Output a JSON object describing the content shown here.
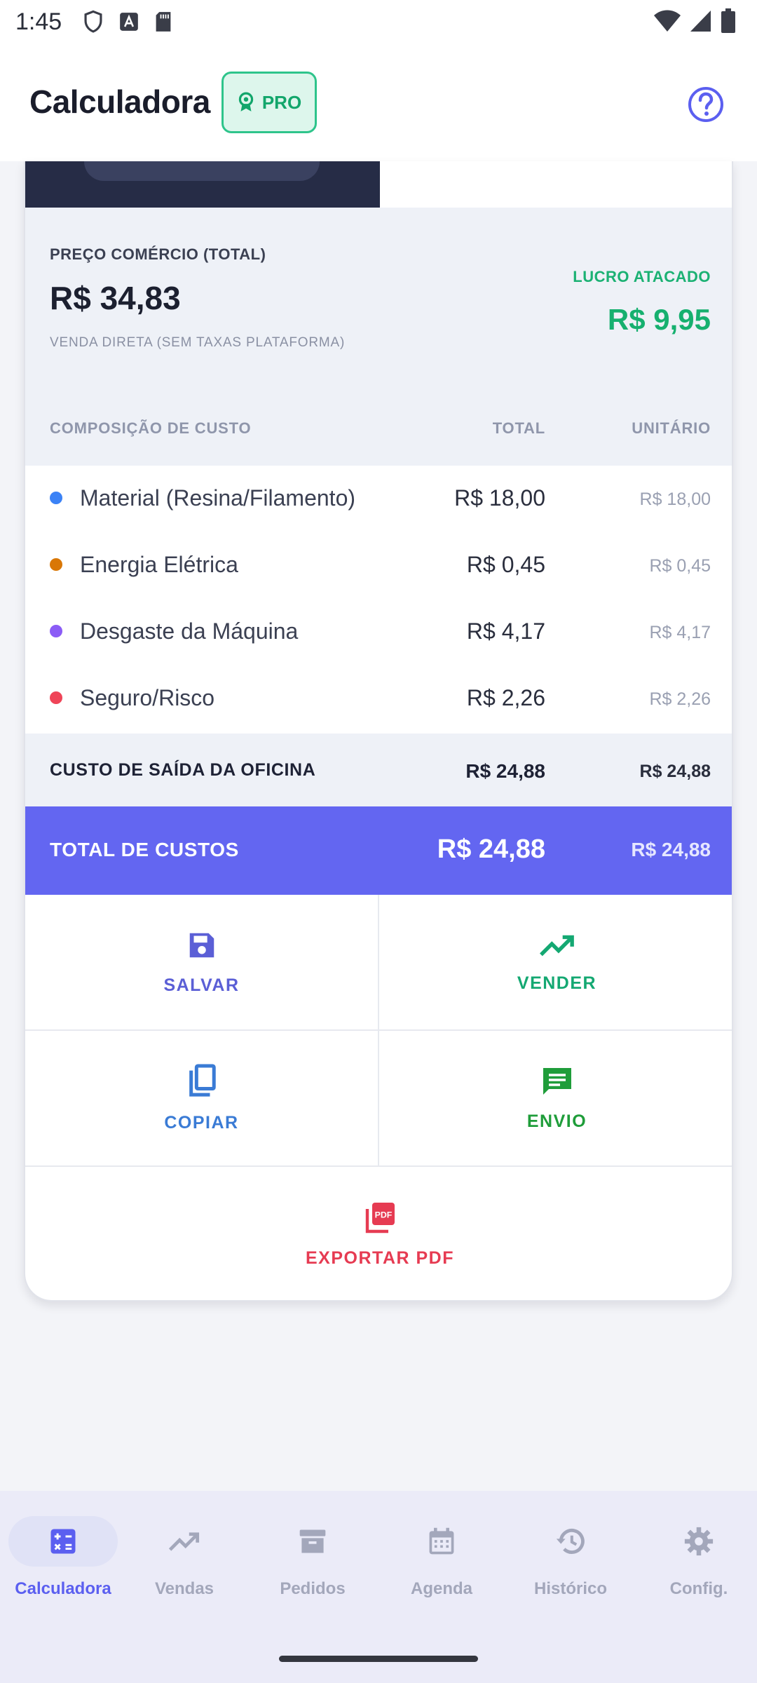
{
  "status_bar": {
    "time": "1:45"
  },
  "app_bar": {
    "title": "Calculadora",
    "pro_badge": "PRO"
  },
  "summary": {
    "label": "PREÇO COMÉRCIO (TOTAL)",
    "price": "R$ 34,83",
    "subtitle": "VENDA DIRETA (SEM TAXAS PLATAFORMA)",
    "profit_label": "LUCRO ATACADO",
    "profit_value": "R$ 9,95"
  },
  "table": {
    "headers": {
      "name": "COMPOSIÇÃO DE CUSTO",
      "total": "TOTAL",
      "unit": "UNITÁRIO"
    },
    "rows": [
      {
        "name": "Material (Resina/Filamento)",
        "total": "R$ 18,00",
        "unit": "R$ 18,00",
        "color": "#3b82f6"
      },
      {
        "name": "Energia Elétrica",
        "total": "R$ 0,45",
        "unit": "R$ 0,45",
        "color": "#d97706"
      },
      {
        "name": "Desgaste da Máquina",
        "total": "R$ 4,17",
        "unit": "R$ 4,17",
        "color": "#8b5cf6"
      },
      {
        "name": "Seguro/Risco",
        "total": "R$ 2,26",
        "unit": "R$ 2,26",
        "color": "#ef4458"
      }
    ],
    "subtotal": {
      "label": "CUSTO DE SAÍDA DA OFICINA",
      "total": "R$ 24,88",
      "unit": "R$ 24,88"
    },
    "grand_total": {
      "label": "TOTAL DE CUSTOS",
      "total": "R$ 24,88",
      "unit": "R$ 24,88"
    }
  },
  "actions": {
    "save": {
      "label": "SALVAR",
      "icon": "save-icon",
      "color": "#5b5fd6"
    },
    "sell": {
      "label": "VENDER",
      "icon": "trending-up-icon",
      "color": "#14a872"
    },
    "copy": {
      "label": "COPIAR",
      "icon": "copy-icon",
      "color": "#3a7bd5"
    },
    "send": {
      "label": "ENVIO",
      "icon": "message-icon",
      "color": "#1f9d3a"
    },
    "pdf": {
      "label": "EXPORTAR PDF",
      "icon": "pdf-icon",
      "color": "#e63b52"
    }
  },
  "nav": {
    "items": [
      {
        "label": "Calculadora",
        "icon": "calculator-icon",
        "active": true
      },
      {
        "label": "Vendas",
        "icon": "trending-up-icon",
        "active": false
      },
      {
        "label": "Pedidos",
        "icon": "archive-icon",
        "active": false
      },
      {
        "label": "Agenda",
        "icon": "calendar-icon",
        "active": false
      },
      {
        "label": "Histórico",
        "icon": "history-icon",
        "active": false
      },
      {
        "label": "Config.",
        "icon": "gear-icon",
        "active": false
      }
    ],
    "accent": "#5b5ff0"
  }
}
